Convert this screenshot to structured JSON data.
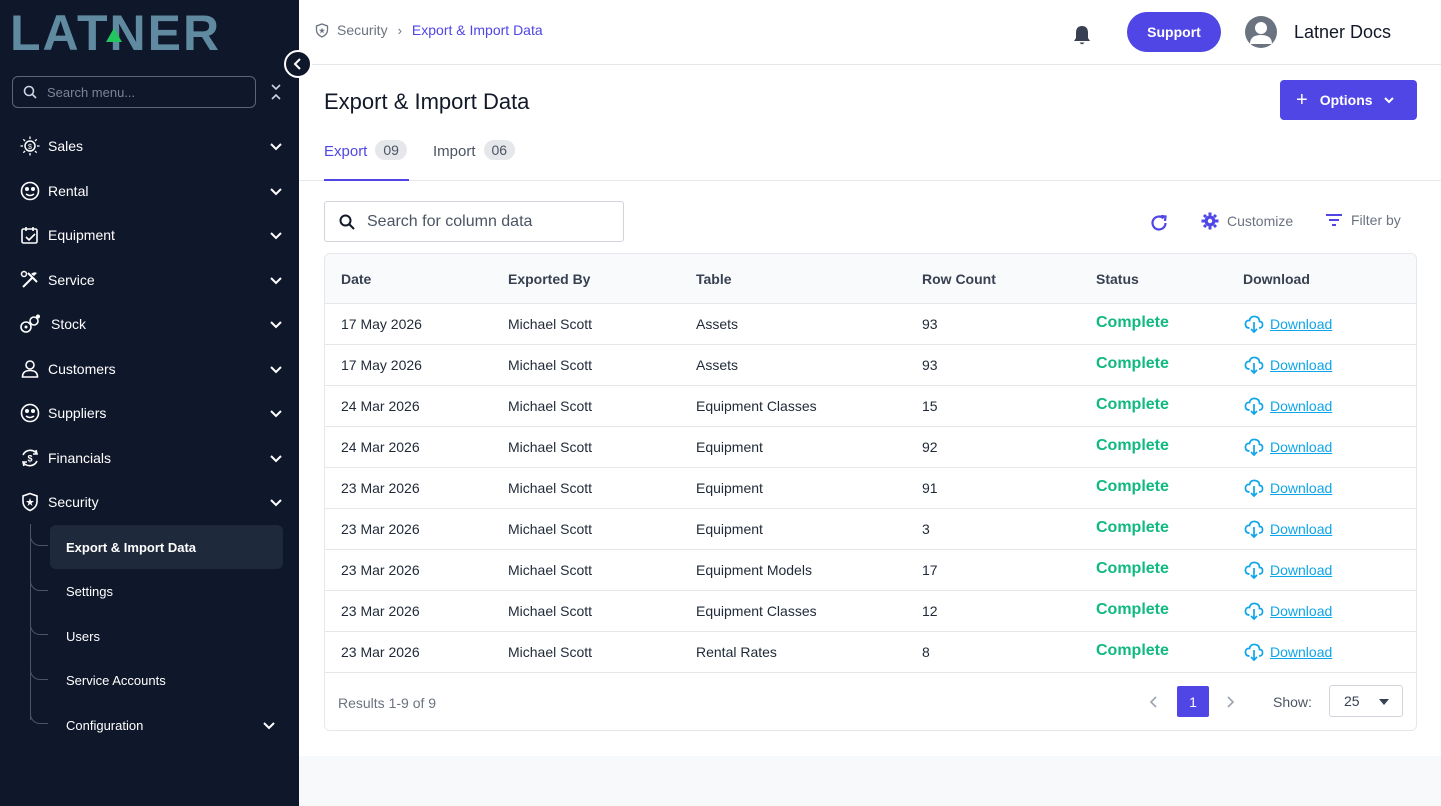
{
  "sidebar": {
    "logo_text": "LATNER",
    "search_placeholder": "Search menu...",
    "items": [
      {
        "label": "Sales",
        "icon": "sales-icon"
      },
      {
        "label": "Rental",
        "icon": "rental-icon"
      },
      {
        "label": "Equipment",
        "icon": "equipment-icon"
      },
      {
        "label": "Service",
        "icon": "service-icon"
      },
      {
        "label": "Stock",
        "icon": "stock-icon"
      },
      {
        "label": "Customers",
        "icon": "customers-icon"
      },
      {
        "label": "Suppliers",
        "icon": "suppliers-icon"
      },
      {
        "label": "Financials",
        "icon": "financials-icon"
      },
      {
        "label": "Security",
        "icon": "security-icon"
      }
    ],
    "sub_items": [
      {
        "label": "Export & Import Data",
        "active": true
      },
      {
        "label": "Settings"
      },
      {
        "label": "Users"
      },
      {
        "label": "Service Accounts"
      },
      {
        "label": "Configuration"
      }
    ]
  },
  "header": {
    "breadcrumb": [
      "Security",
      "Export & Import Data"
    ],
    "support_label": "Support",
    "user_name": "Latner Docs"
  },
  "main": {
    "title": "Export & Import Data",
    "options_label": "Options",
    "tabs": [
      {
        "label": "Export",
        "count": "09",
        "active": true
      },
      {
        "label": "Import",
        "count": "06"
      }
    ],
    "search_placeholder": "Search for column data",
    "customize_label": "Customize",
    "filter_label": "Filter by"
  },
  "table": {
    "columns": [
      "Date",
      "Exported By",
      "Table",
      "Row Count",
      "Status",
      "Download"
    ],
    "rows": [
      {
        "date": "17 May 2026",
        "by": "Michael Scott",
        "table": "Assets",
        "count": "93",
        "status": "Complete",
        "download": "Download"
      },
      {
        "date": "17 May 2026",
        "by": "Michael Scott",
        "table": "Assets",
        "count": "93",
        "status": "Complete",
        "download": "Download"
      },
      {
        "date": "24 Mar 2026",
        "by": "Michael Scott",
        "table": "Equipment Classes",
        "count": "15",
        "status": "Complete",
        "download": "Download"
      },
      {
        "date": "24 Mar 2026",
        "by": "Michael Scott",
        "table": "Equipment",
        "count": "92",
        "status": "Complete",
        "download": "Download"
      },
      {
        "date": "23 Mar 2026",
        "by": "Michael Scott",
        "table": "Equipment",
        "count": "91",
        "status": "Complete",
        "download": "Download"
      },
      {
        "date": "23 Mar 2026",
        "by": "Michael Scott",
        "table": "Equipment",
        "count": "3",
        "status": "Complete",
        "download": "Download"
      },
      {
        "date": "23 Mar 2026",
        "by": "Michael Scott",
        "table": "Equipment Models",
        "count": "17",
        "status": "Complete",
        "download": "Download"
      },
      {
        "date": "23 Mar 2026",
        "by": "Michael Scott",
        "table": "Equipment Classes",
        "count": "12",
        "status": "Complete",
        "download": "Download"
      },
      {
        "date": "23 Mar 2026",
        "by": "Michael Scott",
        "table": "Rental Rates",
        "count": "8",
        "status": "Complete",
        "download": "Download"
      }
    ],
    "results_text": "Results 1-9 of 9",
    "page": "1",
    "show_label": "Show:",
    "page_size": "25"
  },
  "colors": {
    "accent": "#4f46e5",
    "sidebar_bg": "#0f172a",
    "status_complete": "#10b981",
    "link": "#0ea5e9",
    "logo": "#5f8aa0"
  }
}
